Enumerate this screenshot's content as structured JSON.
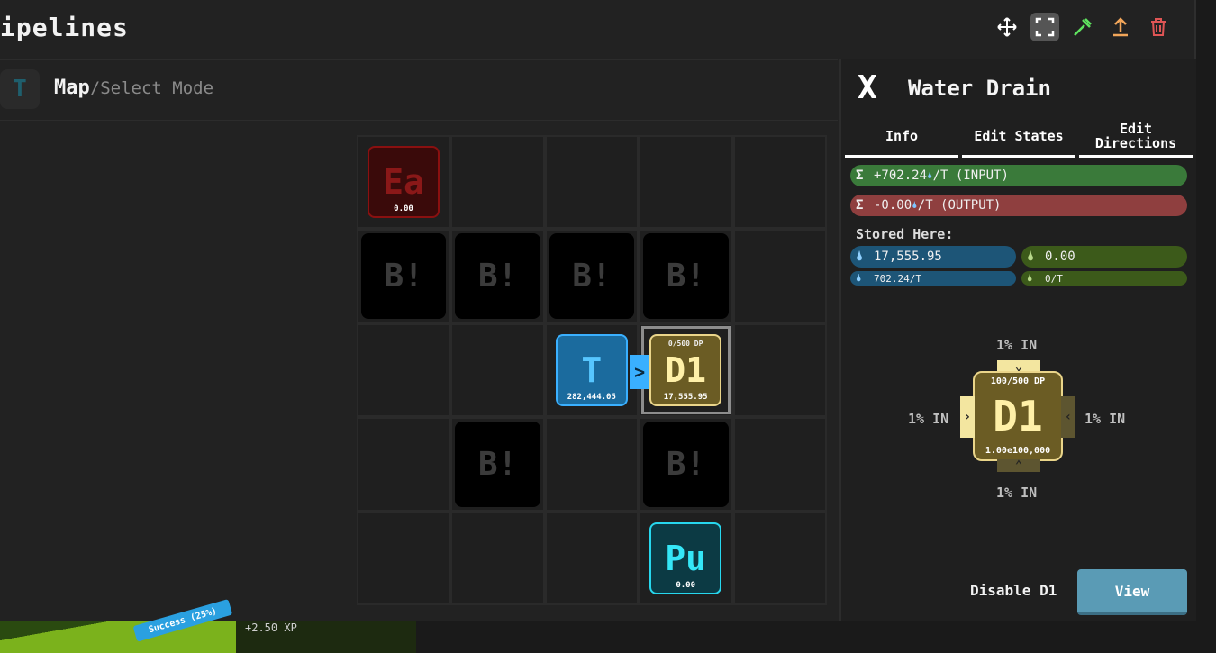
{
  "window": {
    "title": "ipelines"
  },
  "toolbar": {
    "tools": [
      {
        "name": "move",
        "icon": "move-arrows-icon",
        "active": false
      },
      {
        "name": "select",
        "icon": "select-frame-icon",
        "active": true
      },
      {
        "name": "build",
        "icon": "hammer-icon",
        "active": false,
        "color": "#5fe35f"
      },
      {
        "name": "upgrade",
        "icon": "upload-arrow-icon",
        "active": false,
        "color": "#f2a65a"
      },
      {
        "name": "delete",
        "icon": "trash-icon",
        "active": false,
        "color": "#e05555"
      }
    ]
  },
  "map_header": {
    "badge": "T",
    "title": "Map",
    "subtitle": "/Select Mode"
  },
  "grid": {
    "ea": {
      "label": "Ea",
      "amount": "0.00"
    },
    "blocked_label": "B!",
    "t": {
      "label": "T",
      "amount": "282,444.05"
    },
    "d1": {
      "label": "D1",
      "capacity": "0/500 DP",
      "amount": "17,555.95"
    },
    "pu": {
      "label": "Pu",
      "amount": "0.00"
    },
    "flow_arrow": ">"
  },
  "panel": {
    "close": "X",
    "title": "Water Drain",
    "tabs": [
      "Info",
      "Edit States",
      "Edit Directions"
    ],
    "input_rate": "+702.24",
    "input_suffix": "/T (INPUT)",
    "output_rate": "-0.00",
    "output_suffix": "/T (OUTPUT)",
    "stored_label": "Stored Here:",
    "stored": {
      "water_amount": "17,555.95",
      "water_rate": "702.24/T",
      "other_amount": "0.00",
      "other_rate": "0/T"
    },
    "directions": {
      "node_label": "D1",
      "capacity": "100/500 DP",
      "amount": "1.00e100,000",
      "top": "1% IN",
      "left": "1% IN",
      "right": "1% IN",
      "bottom": "1% IN"
    },
    "disable_label": "Disable D1",
    "view_button": "View"
  },
  "status_bar": {
    "success_tag": "Success (25%)",
    "xp": "+2.50 XP"
  },
  "colors": {
    "input_green": "#3a7a3a",
    "output_red": "#8f3f3f",
    "water_blue": "#1d5577",
    "olive": "#3c5a1a",
    "view_button": "#5a9bb5"
  }
}
